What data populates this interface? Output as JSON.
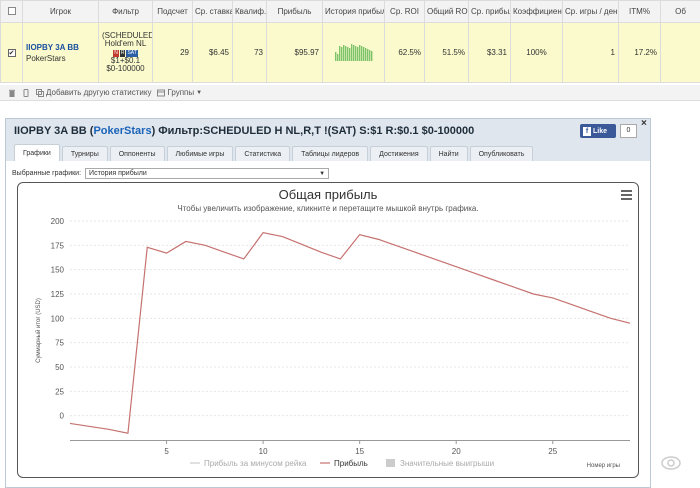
{
  "table": {
    "headers": [
      "",
      "Игрок",
      "Фильтр",
      "Подсчет",
      "Ср. ставка",
      "Квалиф.",
      "Прибыль",
      "История прибыли",
      "Ср. ROI",
      "Общий ROI",
      "Ср. прибыль",
      "Коэффициент",
      "Ср. игры / день",
      "ITM%",
      "Об"
    ],
    "row": {
      "player_name": "IIOPBY 3A BB",
      "player_site": "PokerStars",
      "filter_lines": [
        "(SCHEDULED",
        "Hold'em NL",
        "$1+$0.1",
        "$0-100000"
      ],
      "filter_badges": [
        "N",
        "R",
        "SAT"
      ],
      "count": "29",
      "avg_stake": "$6.45",
      "qualified": "73",
      "profit": "$95.97",
      "avg_roi": "62.5%",
      "total_roi": "51.5%",
      "avg_profit": "$3.31",
      "coefficient": "100%",
      "games_per_day": "1",
      "itm": "17.2%"
    }
  },
  "toolbar": {
    "add_stat": "Добавить другую статистику",
    "groups": "Группы"
  },
  "panel": {
    "title_pre": "IIOPBY 3A BB (",
    "title_site": "PokerStars",
    "title_post": ") Фильтр:SCHEDULED H NL,R,T !(SAT) S:$1 R:$0.1 $0-100000",
    "tabs": [
      "Графики",
      "Турниры",
      "Оппоненты",
      "Любимые игры",
      "Статистика",
      "Таблицы лидеров",
      "Достижения",
      "Найти",
      "Опубликовать"
    ],
    "select_label": "Выбранные графики:",
    "select_value": "История прибыли",
    "fb_like": "Like",
    "fb_count": "0",
    "close": "×"
  },
  "chart_data": {
    "type": "line",
    "title": "Общая прибыль",
    "subtitle": "Чтобы увеличить изображение, кликните и перетащите мышкой внутрь графика.",
    "ylabel": "Суммарный итог (USD)",
    "xlabel": "Номер игры",
    "xlim": [
      0,
      29
    ],
    "ylim": [
      -25,
      200
    ],
    "yticks": [
      0,
      25,
      50,
      75,
      100,
      125,
      150,
      175,
      200
    ],
    "xticks": [
      5,
      10,
      15,
      20,
      25
    ],
    "series": [
      {
        "name": "Прибыль",
        "color": "#c5726f",
        "x": [
          0,
          2,
          3,
          4,
          5,
          6,
          7,
          8,
          9,
          10,
          11,
          12,
          13,
          14,
          15,
          16,
          17,
          18,
          19,
          20,
          21,
          22,
          23,
          24,
          25,
          26,
          27,
          28,
          29
        ],
        "y": [
          -8,
          -14,
          -18,
          173,
          167,
          179,
          175,
          168,
          161,
          188,
          184,
          176,
          168,
          161,
          186,
          181,
          174,
          167,
          160,
          153,
          146,
          139,
          132,
          125,
          121,
          114,
          107,
          100,
          95
        ]
      }
    ],
    "legend": [
      "Прибыль за минусом рейка",
      "Прибыль",
      "Значительные выигрыши"
    ],
    "legend_colors": [
      "#cccccc",
      "#c5726f",
      "#cccccc"
    ],
    "legend_placement": "bottom"
  }
}
